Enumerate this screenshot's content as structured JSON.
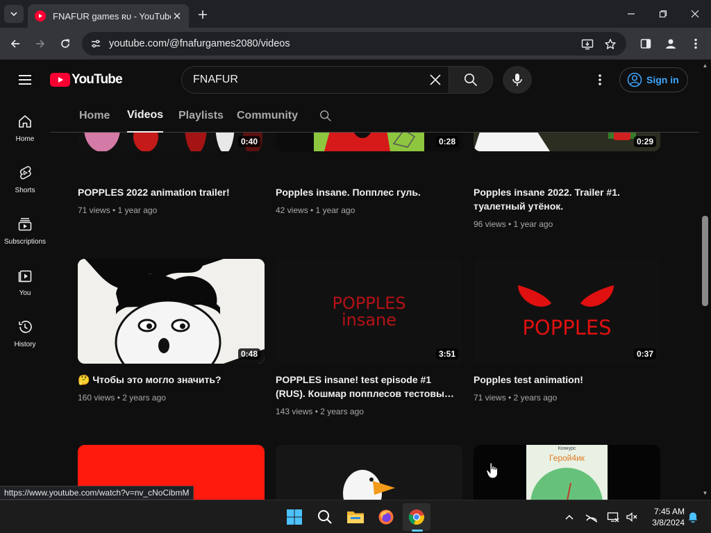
{
  "browser": {
    "tab_title": "FNAFUR games ʀᴜ - YouTube",
    "url": "youtube.com/@fnafurgames2080/videos",
    "status_url": "https://www.youtube.com/watch?v=nv_cNoCibmM"
  },
  "masthead": {
    "logo_text": "YouTube",
    "search_value": "FNAFUR",
    "signin_label": "Sign in"
  },
  "guide": [
    {
      "label": "Home",
      "icon": "home-icon"
    },
    {
      "label": "Shorts",
      "icon": "shorts-icon"
    },
    {
      "label": "Subscriptions",
      "icon": "subscriptions-icon"
    },
    {
      "label": "You",
      "icon": "you-icon"
    },
    {
      "label": "History",
      "icon": "history-icon"
    }
  ],
  "channel_tabs": [
    {
      "label": "Home",
      "active": false
    },
    {
      "label": "Videos",
      "active": true
    },
    {
      "label": "Playlists",
      "active": false
    },
    {
      "label": "Community",
      "active": false
    }
  ],
  "videos": [
    {
      "title": "POPPLES 2022 animation trailer!",
      "meta": "71 views • 1 year ago",
      "duration": "0:40"
    },
    {
      "title": "Popples insane. Попплес гуль.",
      "meta": "42 views • 1 year ago",
      "duration": "0:28"
    },
    {
      "title": "Popples insane 2022. Trailer #1. туалетный утёнок.",
      "meta": "96 views • 1 year ago",
      "duration": "0:29"
    },
    {
      "title": "🤔 Чтобы это могло значить?",
      "meta": "160 views • 2 years ago",
      "duration": "0:48"
    },
    {
      "title": "POPPLES insane! test episode #1 (RUS). Кошмар попплесов тестовы…",
      "meta": "143 views • 2 years ago",
      "duration": "3:51"
    },
    {
      "title": "Popples test animation!",
      "meta": "71 views • 2 years ago",
      "duration": "0:37"
    }
  ],
  "thumb_text": {
    "popples_insane_line1": "POPPLES",
    "popples_insane_line2": "insane",
    "popples": "POPPLES",
    "wheel_caption": "Конкурс",
    "wheel_title": "Герой4ик"
  },
  "taskbar": {
    "time": "7:45 AM",
    "date": "3/8/2024"
  },
  "colors": {
    "yt_red": "#ff0033",
    "link_blue": "#3ea6ff",
    "popples_insane_text": "#b31217",
    "popples_red": "#e01010"
  }
}
